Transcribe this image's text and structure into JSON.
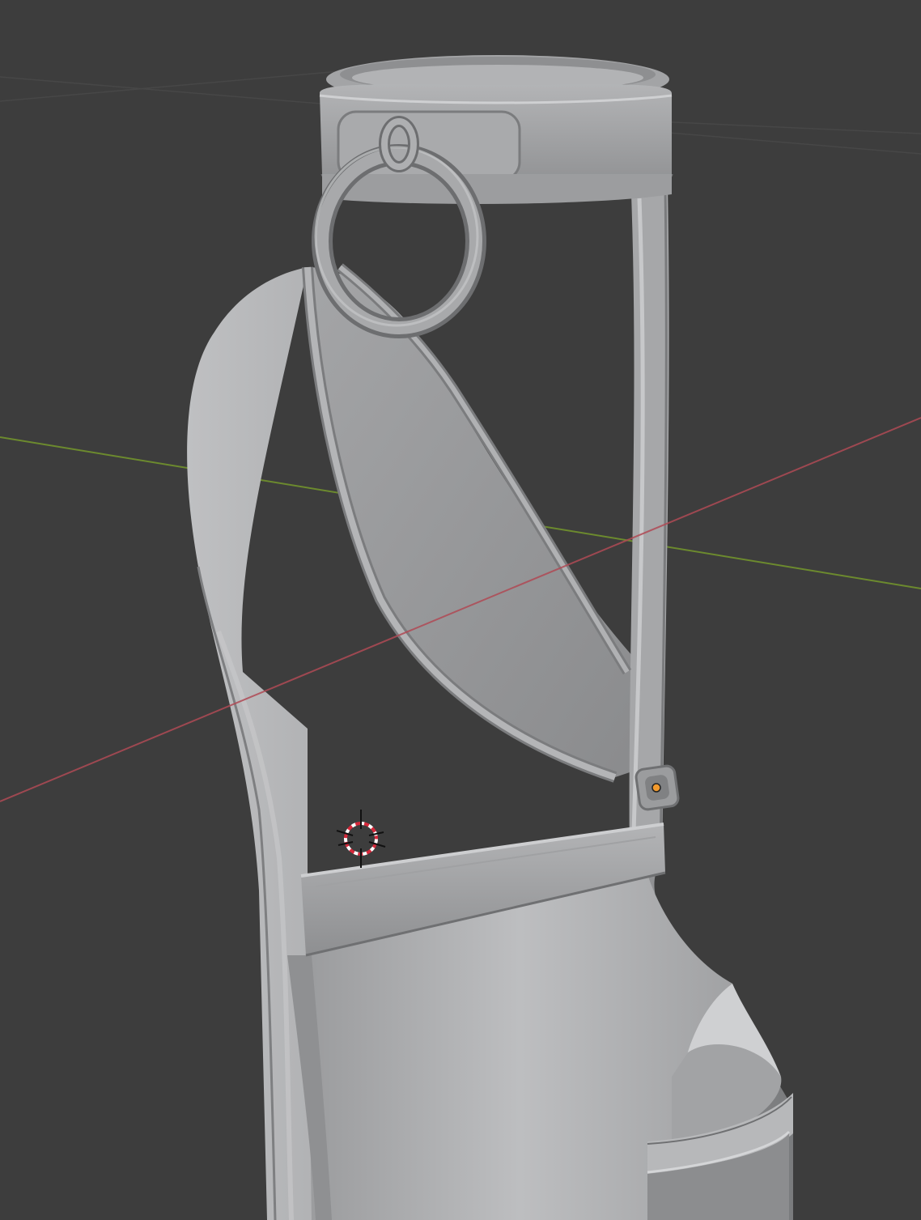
{
  "app": {
    "view": "3D Viewport",
    "shading": "solid"
  },
  "colors": {
    "background": "#3d3d3d",
    "grid_line": "#4a4a4a",
    "x_axis": "#b04a55",
    "y_axis": "#6c8a2e",
    "model_base": "#9a9b9d",
    "model_light": "#c4c5c7",
    "model_dark": "#6e6f71",
    "origin_dot": "#f29a2e"
  },
  "scene": {
    "object": "shoe-model",
    "cursor": "3d-cursor",
    "origin": "object-origin"
  }
}
